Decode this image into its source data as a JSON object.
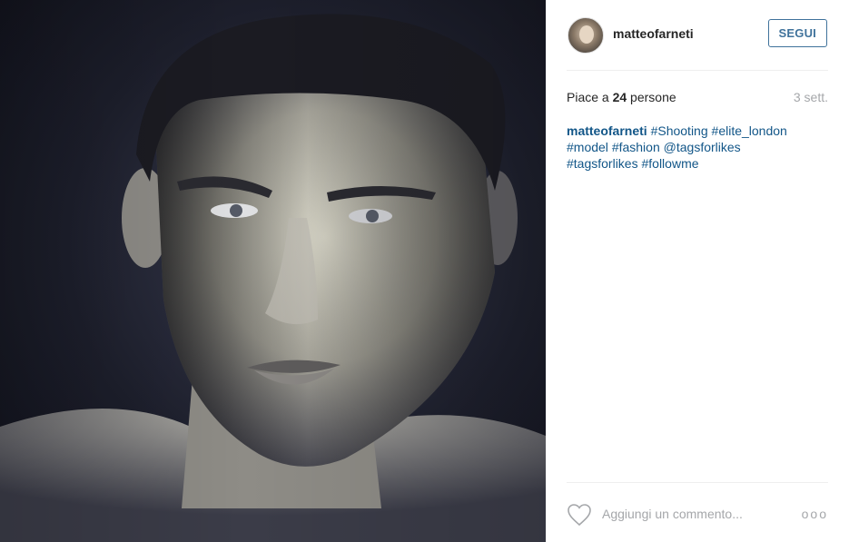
{
  "post": {
    "username": "matteofarneti",
    "follow_label": "SEGUI",
    "likes_prefix": "Piace a ",
    "likes_count": "24",
    "likes_suffix": " persone",
    "time": "3 sett.",
    "caption": {
      "user": "matteofarneti",
      "tags": [
        "#Shooting",
        "#elite_london",
        "#model",
        "#fashion",
        "@tagsforlikes",
        "#tagsforlikes",
        "#followme"
      ]
    },
    "comment_placeholder": "Aggiungi un commento...",
    "more_label": "ooo"
  },
  "colors": {
    "link": "#125688",
    "follow": "#3f729b",
    "muted": "#a5a7aa",
    "divider": "#efefef"
  },
  "icons": {
    "like": "heart-outline-icon",
    "more": "ellipsis-icon"
  }
}
